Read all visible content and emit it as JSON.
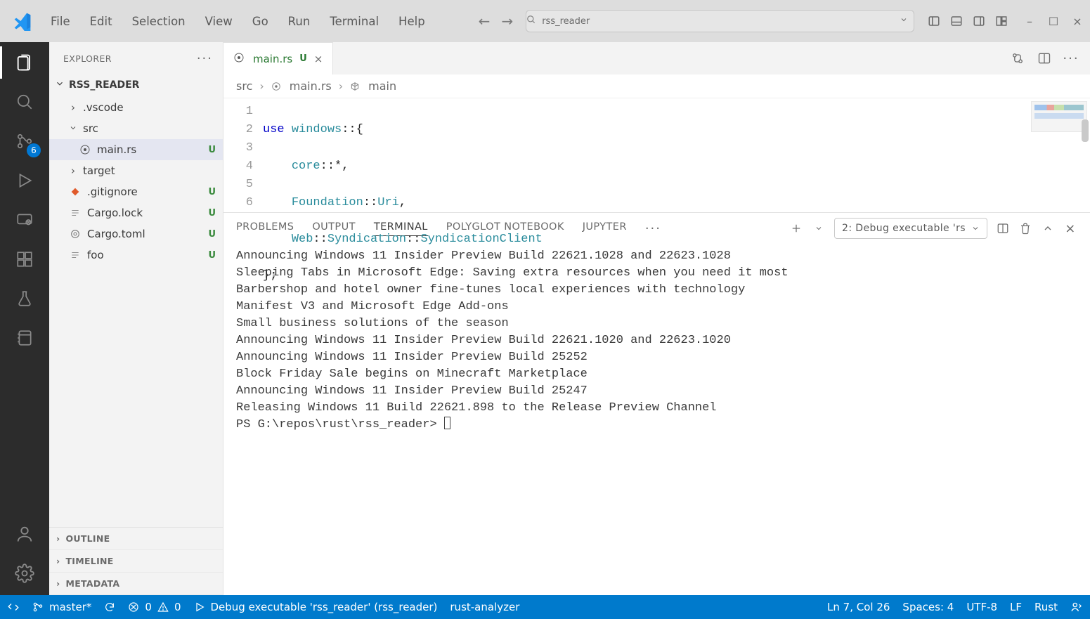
{
  "menu": {
    "file": "File",
    "edit": "Edit",
    "selection": "Selection",
    "view": "View",
    "go": "Go",
    "run": "Run",
    "terminal": "Terminal",
    "help": "Help"
  },
  "search": {
    "placeholder": "rss_reader"
  },
  "activity": {
    "scm_badge": "6"
  },
  "sidebar": {
    "title": "EXPLORER",
    "root": "RSS_READER",
    "items": [
      {
        "label": ".vscode",
        "status": "dot"
      },
      {
        "label": "src",
        "status": "dot"
      },
      {
        "label": "main.rs",
        "status": "U"
      },
      {
        "label": "target",
        "status": ""
      },
      {
        "label": ".gitignore",
        "status": "U"
      },
      {
        "label": "Cargo.lock",
        "status": "U"
      },
      {
        "label": "Cargo.toml",
        "status": "U"
      },
      {
        "label": "foo",
        "status": "U"
      }
    ],
    "sections": {
      "outline": "OUTLINE",
      "timeline": "TIMELINE",
      "metadata": "METADATA"
    }
  },
  "tab": {
    "file": "main.rs",
    "dirty": "U"
  },
  "breadcrumbs": {
    "a": "src",
    "b": "main.rs",
    "c": "main"
  },
  "code": {
    "l1a": "use ",
    "l1b": "windows",
    "l1c": "::{",
    "l2": "    core::*,",
    "l2a": "core",
    "l2b": "::*,",
    "l3a": "Foundation",
    "l3b": "::",
    "l3c": "Uri",
    "l3d": ",",
    "l4a": "Web",
    "l4b": "::",
    "l4c": "Syndication",
    "l4d": "::",
    "l4e": "SyndicationClient",
    "l5": "};",
    "ln": {
      "1": "1",
      "2": "2",
      "3": "3",
      "4": "4",
      "5": "5",
      "6": "6"
    }
  },
  "panel": {
    "tabs": {
      "problems": "PROBLEMS",
      "output": "OUTPUT",
      "terminal": "TERMINAL",
      "polyglot": "POLYGLOT NOTEBOOK",
      "jupyter": "JUPYTER"
    },
    "launch": "2: Debug executable 'rs"
  },
  "terminal": {
    "lines": [
      "Announcing Windows 11 Insider Preview Build 22621.1028 and 22623.1028",
      "Sleeping Tabs in Microsoft Edge: Saving extra resources when you need it most",
      "Barbershop and hotel owner fine-tunes local experiences with technology",
      "Manifest V3 and Microsoft Edge Add-ons",
      "Small business solutions of the season",
      "Announcing Windows 11 Insider Preview Build 22621.1020 and 22623.1020",
      "Announcing Windows 11 Insider Preview Build 25252",
      "Block Friday Sale begins on Minecraft Marketplace",
      "Announcing Windows 11 Insider Preview Build 25247",
      "Releasing Windows 11 Build 22621.898 to the Release Preview Channel"
    ],
    "prompt": "PS G:\\repos\\rust\\rss_reader> "
  },
  "status": {
    "branch": "master*",
    "errors": "0",
    "warnings": "0",
    "debug": "Debug executable 'rss_reader' (rss_reader)",
    "lsp": "rust-analyzer",
    "pos": "Ln 7, Col 26",
    "spaces": "Spaces: 4",
    "enc": "UTF-8",
    "eol": "LF",
    "lang": "Rust"
  }
}
